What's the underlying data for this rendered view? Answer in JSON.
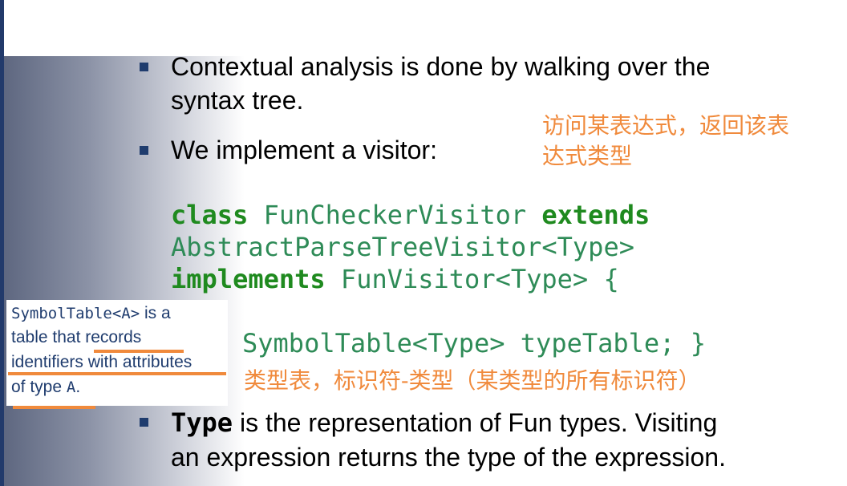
{
  "bullets": {
    "b1_line1": "Contextual analysis is done by walking over the",
    "b1_line2": "syntax tree.",
    "b2": "We implement a visitor:",
    "b3_code": "Type",
    "b3_line1_rest": " is the representation of Fun types. Visiting",
    "b3_line2": "an expression returns the type of the expression."
  },
  "code": {
    "line1_kw1": "class",
    "line1_mid": " FunCheckerVisitor ",
    "line1_kw2": "extends",
    "line2": "AbstractParseTreeVisitor<Type>",
    "line3_kw": "implements",
    "line3_rest": " FunVisitor<Type> {",
    "line4": "SymbolTable<Type> typeTable; }"
  },
  "annotations": {
    "cn_top_line1": "访问某表达式，返回该表",
    "cn_top_line2": "达式类型",
    "cn_bottom": "类型表，标识符-类型（某类型的所有标识符）"
  },
  "note": {
    "line1_code": "SymbolTable<A>",
    "line1_rest": " is a",
    "line2": "table that records",
    "line3": "identifiers with attributes",
    "line4_prefix": "of type ",
    "line4_code": "A",
    "line4_suffix": "."
  },
  "colors": {
    "bullet": "#1f3c6e",
    "keyword": "#1f8a1f",
    "code": "#2e8b57",
    "annotation": "#f08a3c",
    "note_text": "#1f3c6e"
  }
}
